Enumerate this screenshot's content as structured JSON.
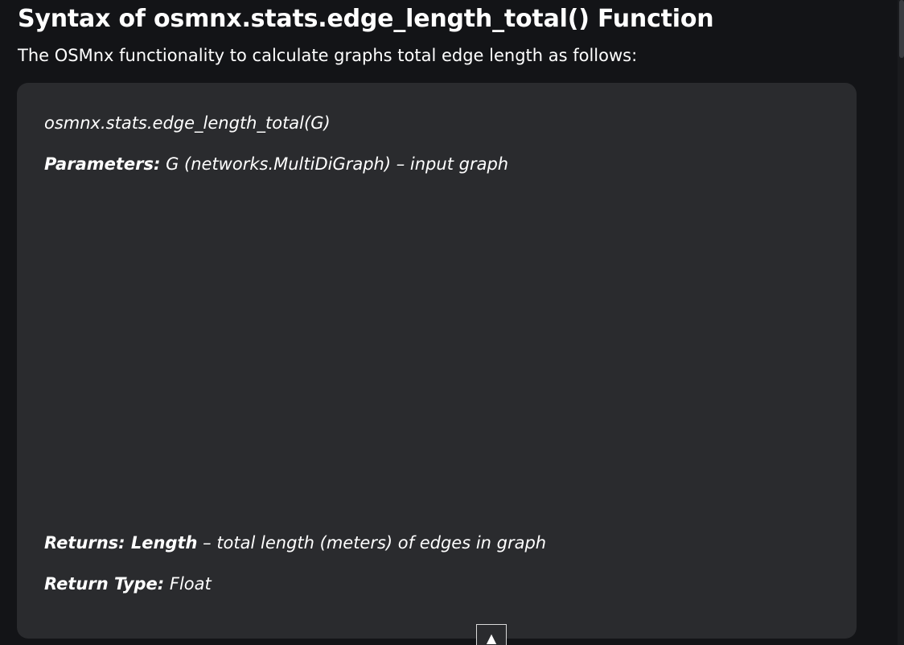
{
  "heading": {
    "title": "Syntax of osmnx.stats.edge_length_total() Function",
    "intro": "The OSMnx functionality to calculate graphs total edge length as follows:"
  },
  "code_block": {
    "signature": "osmnx.stats.edge_length_total(G)",
    "parameters_label": "Parameters:",
    "parameters_text": " G (networks.MultiDiGraph) – input graph",
    "returns_label": "Returns: Length",
    "returns_text": " – total length (meters) of edges in graph",
    "return_type_label": "Return Type:",
    "return_type_text": " Float"
  },
  "controls": {
    "scroll_top_glyph": "▲",
    "scroll_top_icon": "up-arrow-icon"
  },
  "colors": {
    "background": "#131417",
    "code_background": "#2a2b2e",
    "text": "#ffffff"
  }
}
